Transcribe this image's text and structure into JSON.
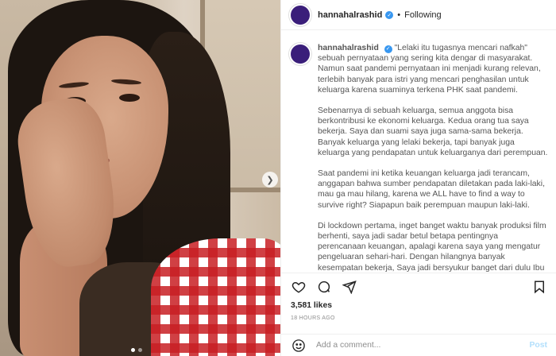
{
  "post": {
    "username": "hannahalrashid",
    "verified_icon": "verified-badge-icon",
    "separator": "•",
    "follow_status": "Following",
    "caption_paragraphs": [
      "\"Lelaki itu tugasnya mencari nafkah\" sebuah pernyataan yang sering kita dengar di masyarakat. Namun saat pandemi pernyataan ini menjadi kurang relevan, terlebih banyak para istri yang mencari penghasilan untuk keluarga karena suaminya terkena PHK saat pandemi.",
      "Sebenarnya di sebuah keluarga, semua anggota bisa berkontribusi ke ekonomi keluarga. Kedua orang tua saya bekerja. Saya dan suami saya juga sama-sama bekerja. Banyak keluarga yang lelaki bekerja, tapi banyak juga keluarga yang pendapatan untuk keluarganya dari perempuan.",
      "Saat pandemi ini ketika keuangan keluarga jadi terancam, anggapan bahwa sumber pendapatan diletakan pada laki-laki, mau ga mau hilang, karena we ALL have to find a way to survive right? Siapapun baik perempuan maupun laki-laki.",
      "Di lockdown pertama, inget banget waktu banyak produksi film berhenti, saya jadi sadar betul betapa pentingnya perencanaan keuangan, apalagi karena saya yang mengatur pengeluaran sehari-hari. Dengan hilangnya banyak kesempatan bekerja, Saya jadi bersyukur banget dari dulu Ibu selalu ingetin untuk nabung, biar ada \"safety net\" karena kita ga pernah tau kapan masa-masa sulit"
    ],
    "likes": "3,581 likes",
    "timestamp": "18 HOURS AGO",
    "comment_placeholder": "Add a comment...",
    "post_button": "Post",
    "carousel": {
      "slide_count": 2,
      "current_slide": 1
    },
    "colors": {
      "avatar": "#3a1e7a",
      "verified": "#3897f0",
      "post_disabled": "#b2dffc"
    }
  }
}
